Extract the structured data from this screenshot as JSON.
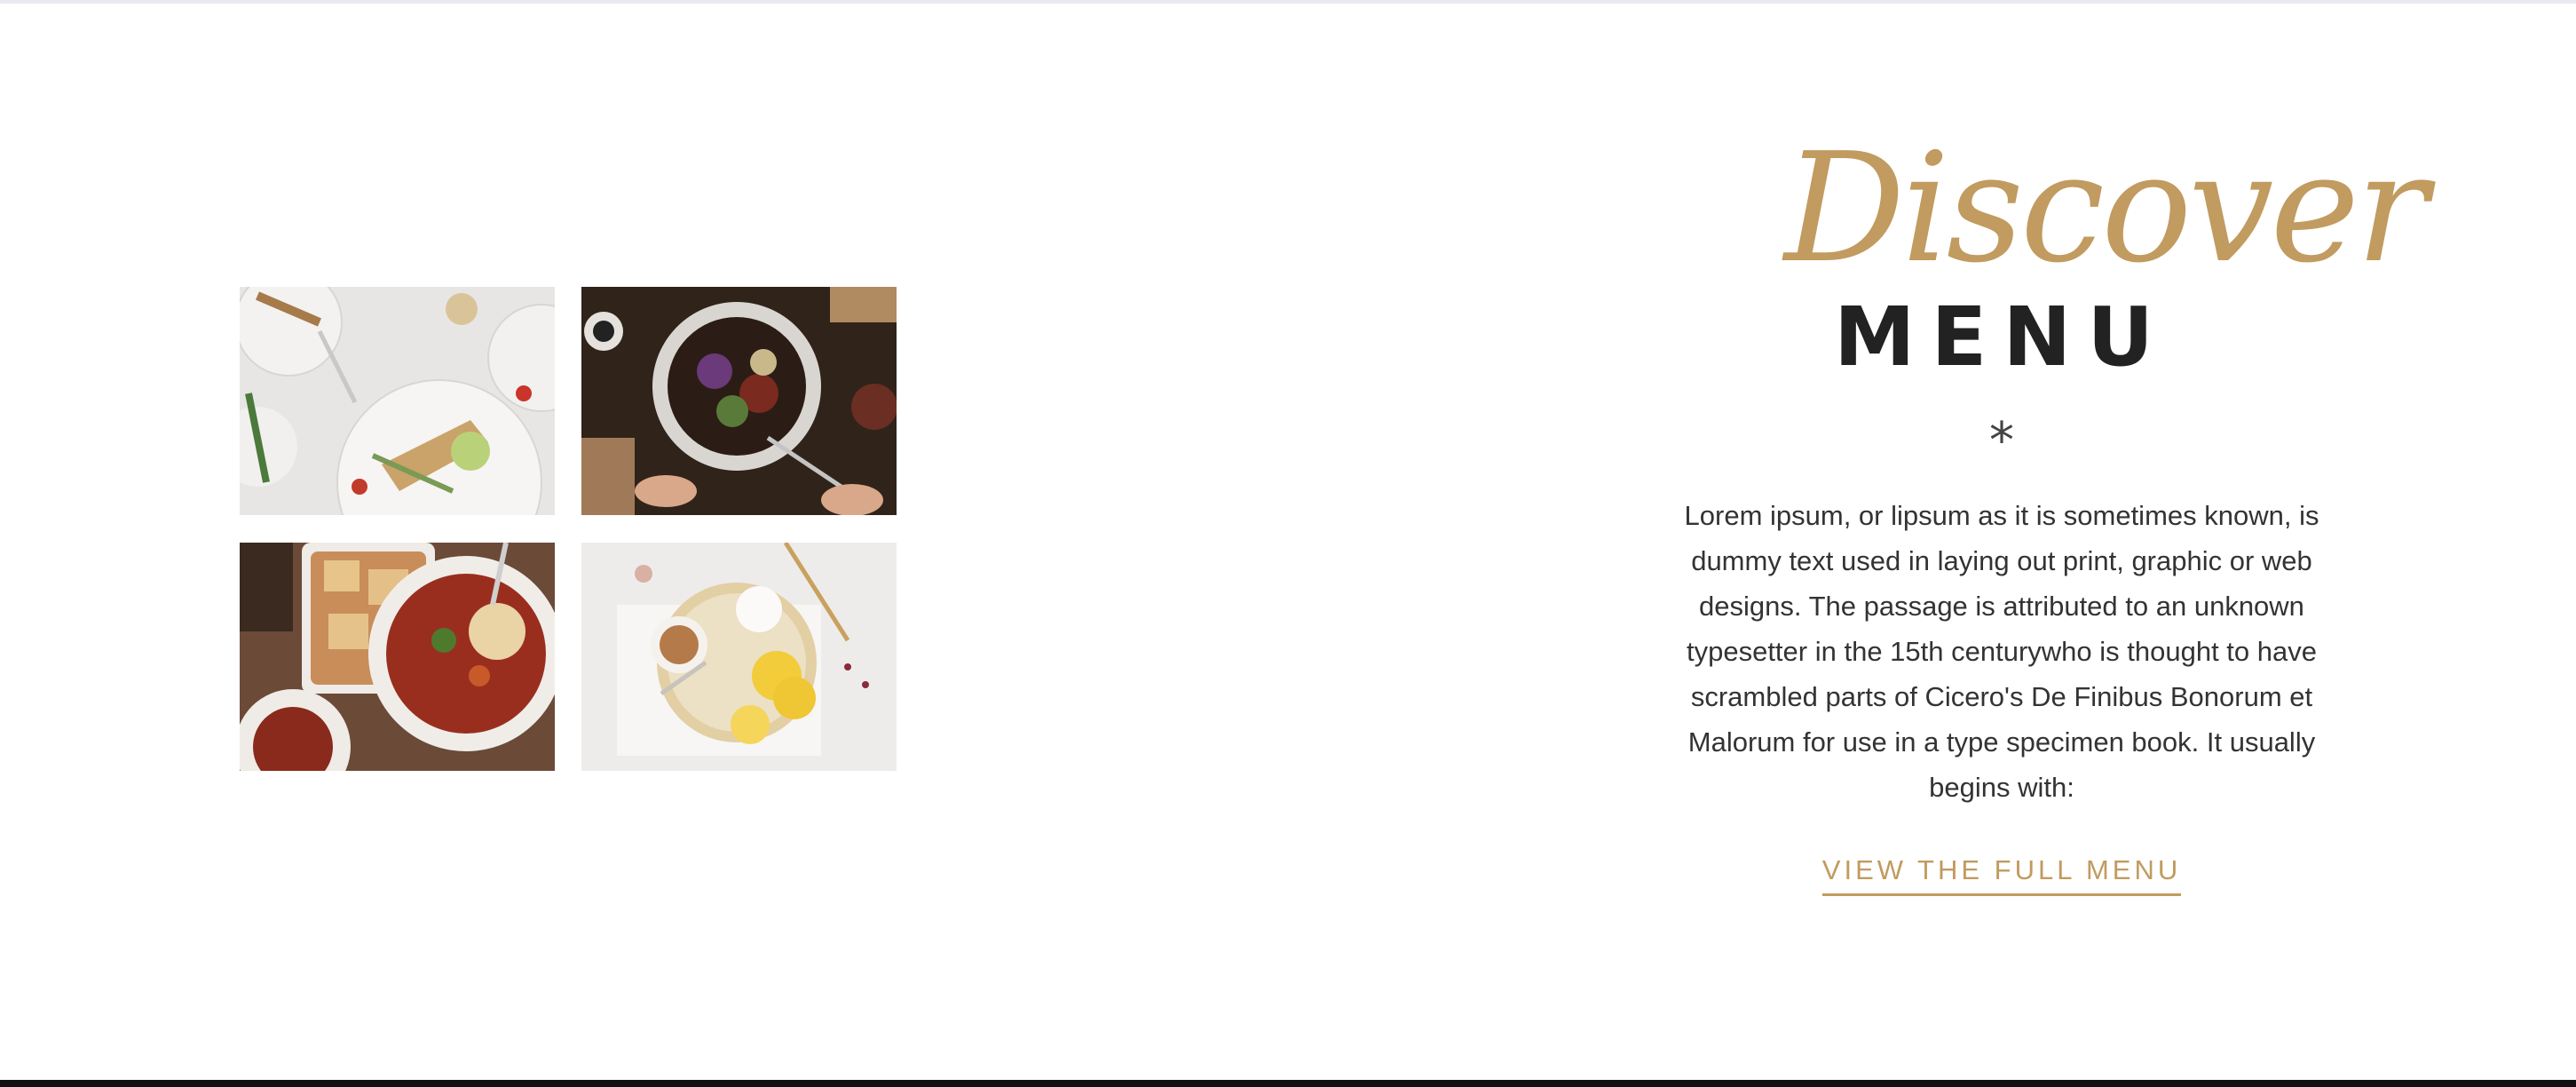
{
  "section": {
    "script_title": "Discover",
    "heading": "MENU",
    "divider_glyph": "*",
    "description": "Lorem ipsum, or lipsum as it is sometimes known, is dummy text used in laying out print, graphic or web designs. The passage is attributed to an unknown typesetter in the 15th centurywho is thought to have scrambled parts of Cicero's De Finibus Bonorum et Malorum for use in a type specimen book. It usually begins with:",
    "cta_label": "VIEW THE FULL MENU"
  },
  "colors": {
    "accent": "#c19b5f",
    "heading": "#222222",
    "body_text": "#333333"
  }
}
